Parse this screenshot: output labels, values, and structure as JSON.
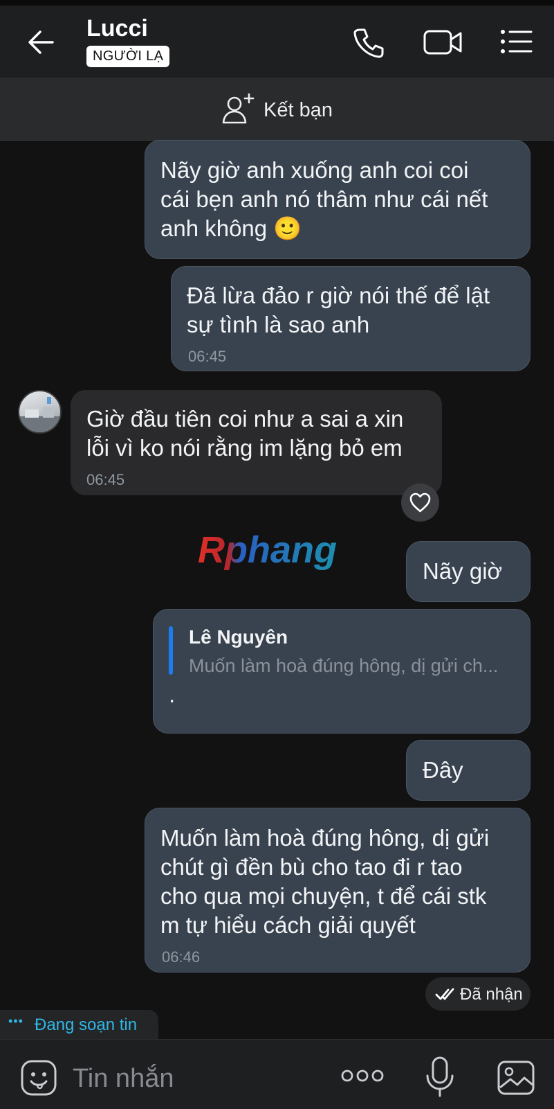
{
  "header": {
    "title": "Lucci",
    "badge": "NGƯỜI LẠ",
    "back_icon": "arrow-left-icon",
    "call_icon": "phone-icon",
    "video_icon": "video-camera-icon",
    "menu_icon": "menu-list-icon"
  },
  "friend_bar": {
    "label": "Kết bạn",
    "icon": "add-friend-icon"
  },
  "messages": [
    {
      "id": "m1",
      "direction": "sent",
      "text": "Nãy giờ anh xuống anh coi coi\ncái bẹn anh nó thâm như cái nết\nanh không 🙂",
      "time": ""
    },
    {
      "id": "m2",
      "direction": "sent",
      "text": "Đã lừa đảo r giờ nói thế để lật\nsự tình là sao anh",
      "time": "06:45"
    },
    {
      "id": "m3",
      "direction": "received",
      "text": "Giờ đầu tiên coi như a sai a xin\nlỗi vì ko nói rằng im lặng bỏ em",
      "time": "06:45"
    },
    {
      "id": "m4",
      "direction": "sent",
      "text": "Nãy giờ",
      "time": ""
    },
    {
      "id": "m5",
      "direction": "sent",
      "quote": {
        "name": "Lê Nguyên",
        "text": "Muốn làm hoà đúng hông, dị gửi ch..."
      },
      "text": ".",
      "time": ""
    },
    {
      "id": "m6",
      "direction": "sent",
      "text": "Đây",
      "time": ""
    },
    {
      "id": "m7",
      "direction": "sent",
      "text": "Muốn làm hoà đúng hông, dị gửi\nchút gì đền bù cho tao đi r tao\ncho qua mọi chuyện, t để cái stk\nm tự hiểu cách giải quyết",
      "time": "06:46"
    }
  ],
  "watermark": "Rphang",
  "status": {
    "received": "Đã nhận",
    "typing": "Đang soạn tin",
    "typing_dots": "•••"
  },
  "composer": {
    "placeholder": "Tin nhắn",
    "value": "",
    "emoji_icon": "sticker-emoji-icon",
    "more_icon": "more-dots-icon",
    "mic_icon": "microphone-icon",
    "image_icon": "image-gallery-icon"
  },
  "colors": {
    "background": "#121212",
    "header": "#1e1f21",
    "sent_bubble": "#39434f",
    "received_bubble": "#2a2a2c",
    "quote_accent": "#1e7cf2",
    "typing_text": "#2fb7e6"
  }
}
